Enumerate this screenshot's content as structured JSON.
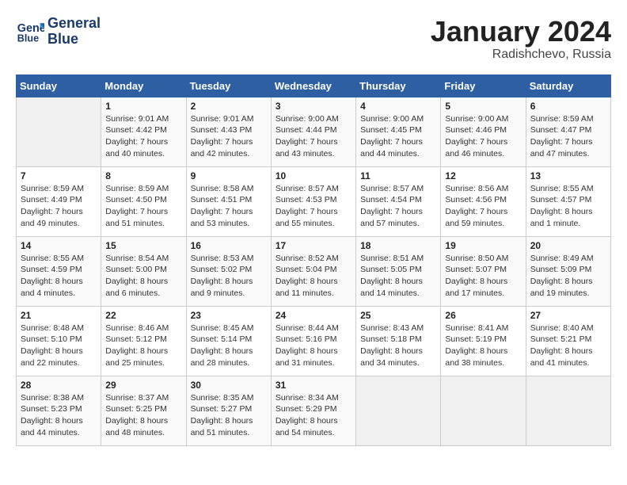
{
  "header": {
    "logo_line1": "General",
    "logo_line2": "Blue",
    "month": "January 2024",
    "location": "Radishchevo, Russia"
  },
  "days_of_week": [
    "Sunday",
    "Monday",
    "Tuesday",
    "Wednesday",
    "Thursday",
    "Friday",
    "Saturday"
  ],
  "weeks": [
    [
      {
        "day": "",
        "sunrise": "",
        "sunset": "",
        "daylight": ""
      },
      {
        "day": "1",
        "sunrise": "Sunrise: 9:01 AM",
        "sunset": "Sunset: 4:42 PM",
        "daylight": "Daylight: 7 hours and 40 minutes."
      },
      {
        "day": "2",
        "sunrise": "Sunrise: 9:01 AM",
        "sunset": "Sunset: 4:43 PM",
        "daylight": "Daylight: 7 hours and 42 minutes."
      },
      {
        "day": "3",
        "sunrise": "Sunrise: 9:00 AM",
        "sunset": "Sunset: 4:44 PM",
        "daylight": "Daylight: 7 hours and 43 minutes."
      },
      {
        "day": "4",
        "sunrise": "Sunrise: 9:00 AM",
        "sunset": "Sunset: 4:45 PM",
        "daylight": "Daylight: 7 hours and 44 minutes."
      },
      {
        "day": "5",
        "sunrise": "Sunrise: 9:00 AM",
        "sunset": "Sunset: 4:46 PM",
        "daylight": "Daylight: 7 hours and 46 minutes."
      },
      {
        "day": "6",
        "sunrise": "Sunrise: 8:59 AM",
        "sunset": "Sunset: 4:47 PM",
        "daylight": "Daylight: 7 hours and 47 minutes."
      }
    ],
    [
      {
        "day": "7",
        "sunrise": "Sunrise: 8:59 AM",
        "sunset": "Sunset: 4:49 PM",
        "daylight": "Daylight: 7 hours and 49 minutes."
      },
      {
        "day": "8",
        "sunrise": "Sunrise: 8:59 AM",
        "sunset": "Sunset: 4:50 PM",
        "daylight": "Daylight: 7 hours and 51 minutes."
      },
      {
        "day": "9",
        "sunrise": "Sunrise: 8:58 AM",
        "sunset": "Sunset: 4:51 PM",
        "daylight": "Daylight: 7 hours and 53 minutes."
      },
      {
        "day": "10",
        "sunrise": "Sunrise: 8:57 AM",
        "sunset": "Sunset: 4:53 PM",
        "daylight": "Daylight: 7 hours and 55 minutes."
      },
      {
        "day": "11",
        "sunrise": "Sunrise: 8:57 AM",
        "sunset": "Sunset: 4:54 PM",
        "daylight": "Daylight: 7 hours and 57 minutes."
      },
      {
        "day": "12",
        "sunrise": "Sunrise: 8:56 AM",
        "sunset": "Sunset: 4:56 PM",
        "daylight": "Daylight: 7 hours and 59 minutes."
      },
      {
        "day": "13",
        "sunrise": "Sunrise: 8:55 AM",
        "sunset": "Sunset: 4:57 PM",
        "daylight": "Daylight: 8 hours and 1 minute."
      }
    ],
    [
      {
        "day": "14",
        "sunrise": "Sunrise: 8:55 AM",
        "sunset": "Sunset: 4:59 PM",
        "daylight": "Daylight: 8 hours and 4 minutes."
      },
      {
        "day": "15",
        "sunrise": "Sunrise: 8:54 AM",
        "sunset": "Sunset: 5:00 PM",
        "daylight": "Daylight: 8 hours and 6 minutes."
      },
      {
        "day": "16",
        "sunrise": "Sunrise: 8:53 AM",
        "sunset": "Sunset: 5:02 PM",
        "daylight": "Daylight: 8 hours and 9 minutes."
      },
      {
        "day": "17",
        "sunrise": "Sunrise: 8:52 AM",
        "sunset": "Sunset: 5:04 PM",
        "daylight": "Daylight: 8 hours and 11 minutes."
      },
      {
        "day": "18",
        "sunrise": "Sunrise: 8:51 AM",
        "sunset": "Sunset: 5:05 PM",
        "daylight": "Daylight: 8 hours and 14 minutes."
      },
      {
        "day": "19",
        "sunrise": "Sunrise: 8:50 AM",
        "sunset": "Sunset: 5:07 PM",
        "daylight": "Daylight: 8 hours and 17 minutes."
      },
      {
        "day": "20",
        "sunrise": "Sunrise: 8:49 AM",
        "sunset": "Sunset: 5:09 PM",
        "daylight": "Daylight: 8 hours and 19 minutes."
      }
    ],
    [
      {
        "day": "21",
        "sunrise": "Sunrise: 8:48 AM",
        "sunset": "Sunset: 5:10 PM",
        "daylight": "Daylight: 8 hours and 22 minutes."
      },
      {
        "day": "22",
        "sunrise": "Sunrise: 8:46 AM",
        "sunset": "Sunset: 5:12 PM",
        "daylight": "Daylight: 8 hours and 25 minutes."
      },
      {
        "day": "23",
        "sunrise": "Sunrise: 8:45 AM",
        "sunset": "Sunset: 5:14 PM",
        "daylight": "Daylight: 8 hours and 28 minutes."
      },
      {
        "day": "24",
        "sunrise": "Sunrise: 8:44 AM",
        "sunset": "Sunset: 5:16 PM",
        "daylight": "Daylight: 8 hours and 31 minutes."
      },
      {
        "day": "25",
        "sunrise": "Sunrise: 8:43 AM",
        "sunset": "Sunset: 5:18 PM",
        "daylight": "Daylight: 8 hours and 34 minutes."
      },
      {
        "day": "26",
        "sunrise": "Sunrise: 8:41 AM",
        "sunset": "Sunset: 5:19 PM",
        "daylight": "Daylight: 8 hours and 38 minutes."
      },
      {
        "day": "27",
        "sunrise": "Sunrise: 8:40 AM",
        "sunset": "Sunset: 5:21 PM",
        "daylight": "Daylight: 8 hours and 41 minutes."
      }
    ],
    [
      {
        "day": "28",
        "sunrise": "Sunrise: 8:38 AM",
        "sunset": "Sunset: 5:23 PM",
        "daylight": "Daylight: 8 hours and 44 minutes."
      },
      {
        "day": "29",
        "sunrise": "Sunrise: 8:37 AM",
        "sunset": "Sunset: 5:25 PM",
        "daylight": "Daylight: 8 hours and 48 minutes."
      },
      {
        "day": "30",
        "sunrise": "Sunrise: 8:35 AM",
        "sunset": "Sunset: 5:27 PM",
        "daylight": "Daylight: 8 hours and 51 minutes."
      },
      {
        "day": "31",
        "sunrise": "Sunrise: 8:34 AM",
        "sunset": "Sunset: 5:29 PM",
        "daylight": "Daylight: 8 hours and 54 minutes."
      },
      {
        "day": "",
        "sunrise": "",
        "sunset": "",
        "daylight": ""
      },
      {
        "day": "",
        "sunrise": "",
        "sunset": "",
        "daylight": ""
      },
      {
        "day": "",
        "sunrise": "",
        "sunset": "",
        "daylight": ""
      }
    ]
  ]
}
